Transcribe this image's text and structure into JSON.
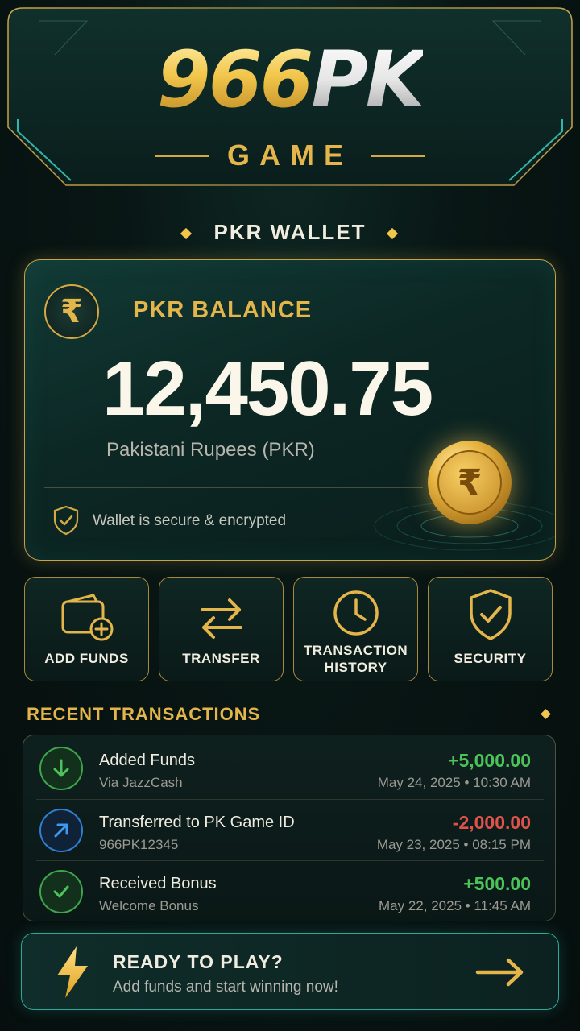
{
  "header": {
    "logo_number": "966",
    "logo_letters": "PK",
    "subtitle": "GAME"
  },
  "wallet": {
    "section_title": "PKR WALLET",
    "balance_label": "PKR BALANCE",
    "balance_amount": "12,450.75",
    "currency_label": "Pakistani Rupees (PKR)",
    "currency_symbol": "₹",
    "security_note": "Wallet is secure & encrypted"
  },
  "actions": [
    {
      "label": "ADD FUNDS",
      "icon": "wallet-add-icon"
    },
    {
      "label": "TRANSFER",
      "icon": "transfer-arrows-icon"
    },
    {
      "label_line1": "TRANSACTION",
      "label_line2": "HISTORY",
      "icon": "clock-icon"
    },
    {
      "label": "SECURITY",
      "icon": "shield-check-icon"
    }
  ],
  "recent": {
    "title": "RECENT TRANSACTIONS",
    "items": [
      {
        "title": "Added Funds",
        "subtitle": "Via JazzCash",
        "amount": "+5,000.00",
        "date": "May 24, 2025 • 10:30 AM",
        "type": "credit",
        "icon": "arrow-down-icon"
      },
      {
        "title": "Transferred to PK Game ID",
        "subtitle": "966PK12345",
        "amount": "-2,000.00",
        "date": "May 23, 2025 • 08:15 PM",
        "type": "debit",
        "icon": "arrow-up-right-icon"
      },
      {
        "title": "Received Bonus",
        "subtitle": "Welcome Bonus",
        "amount": "+500.00",
        "date": "May 22, 2025 • 11:45 AM",
        "type": "credit",
        "icon": "checkmark-icon"
      }
    ]
  },
  "cta": {
    "title": "READY TO PLAY?",
    "subtitle": "Add funds and start winning now!",
    "icon": "lightning-bolt-icon"
  },
  "colors": {
    "gold": "#e4b54a",
    "teal": "#2fa89a",
    "credit": "#4cc35a",
    "debit": "#e0534c",
    "background": "#081614"
  }
}
